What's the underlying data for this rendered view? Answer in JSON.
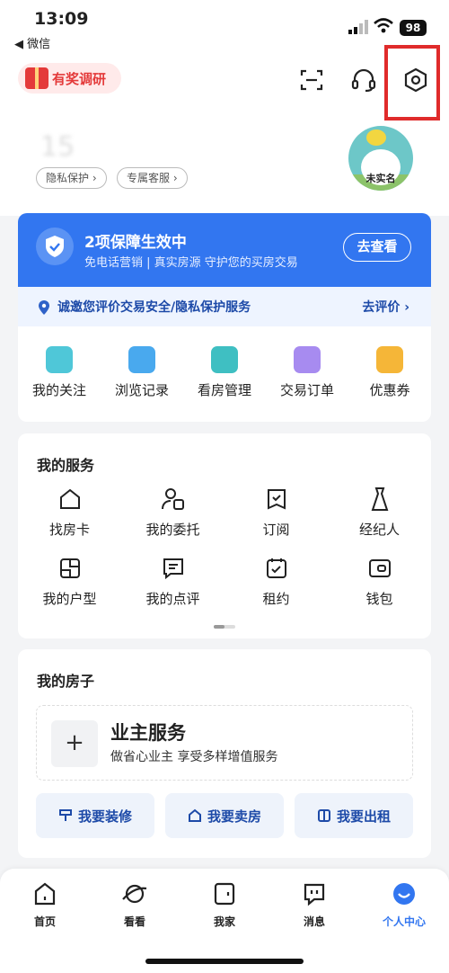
{
  "status_bar": {
    "time": "13:09",
    "back_app": "◀ 微信",
    "battery": "98"
  },
  "header": {
    "reward_label": "有奖调研",
    "icons": [
      "scan-icon",
      "headset-icon",
      "settings-icon"
    ]
  },
  "profile": {
    "name_blurred": "15",
    "pills": [
      "隐私保护 ›",
      "专属客服 ›"
    ],
    "avatar_label": "未实名"
  },
  "guarantee": {
    "title": "2项保障生效中",
    "subtitle": "免电话营销 | 真实房源  守护您的买房交易",
    "button": "去查看"
  },
  "invite": {
    "text": "诚邀您评价交易安全/隐私保护服务",
    "link": "去评价 ›"
  },
  "quick_links": [
    {
      "label": "我的关注",
      "color": "#4fc7d8",
      "icon": "heart-icon"
    },
    {
      "label": "浏览记录",
      "color": "#49a9ee",
      "icon": "history-icon"
    },
    {
      "label": "看房管理",
      "color": "#3fbfc2",
      "icon": "camera-icon"
    },
    {
      "label": "交易订单",
      "color": "#a78bf0",
      "icon": "order-icon"
    },
    {
      "label": "优惠券",
      "color": "#f5b638",
      "icon": "coupon-icon"
    }
  ],
  "services": {
    "title": "我的服务",
    "items": [
      {
        "label": "找房卡",
        "icon": "house-card-icon"
      },
      {
        "label": "我的委托",
        "icon": "commission-icon"
      },
      {
        "label": "订阅",
        "icon": "subscribe-icon"
      },
      {
        "label": "经纪人",
        "icon": "agent-icon"
      },
      {
        "label": "我的户型",
        "icon": "floorplan-icon"
      },
      {
        "label": "我的点评",
        "icon": "review-icon"
      },
      {
        "label": "租约",
        "icon": "lease-icon"
      },
      {
        "label": "钱包",
        "icon": "wallet-icon"
      }
    ]
  },
  "my_house": {
    "title": "我的房子",
    "owner_title": "业主服务",
    "owner_sub": "做省心业主 享受多样增值服务",
    "actions": [
      "我要装修",
      "我要卖房",
      "我要出租"
    ]
  },
  "tabs": [
    {
      "label": "首页",
      "icon": "home-icon"
    },
    {
      "label": "看看",
      "icon": "planet-icon"
    },
    {
      "label": "我家",
      "icon": "door-icon"
    },
    {
      "label": "消息",
      "icon": "message-icon"
    },
    {
      "label": "个人中心",
      "icon": "smile-icon"
    }
  ],
  "colors": {
    "primary": "#3276f0",
    "reward": "#e43a3a",
    "highlight": "#e02b2b"
  }
}
